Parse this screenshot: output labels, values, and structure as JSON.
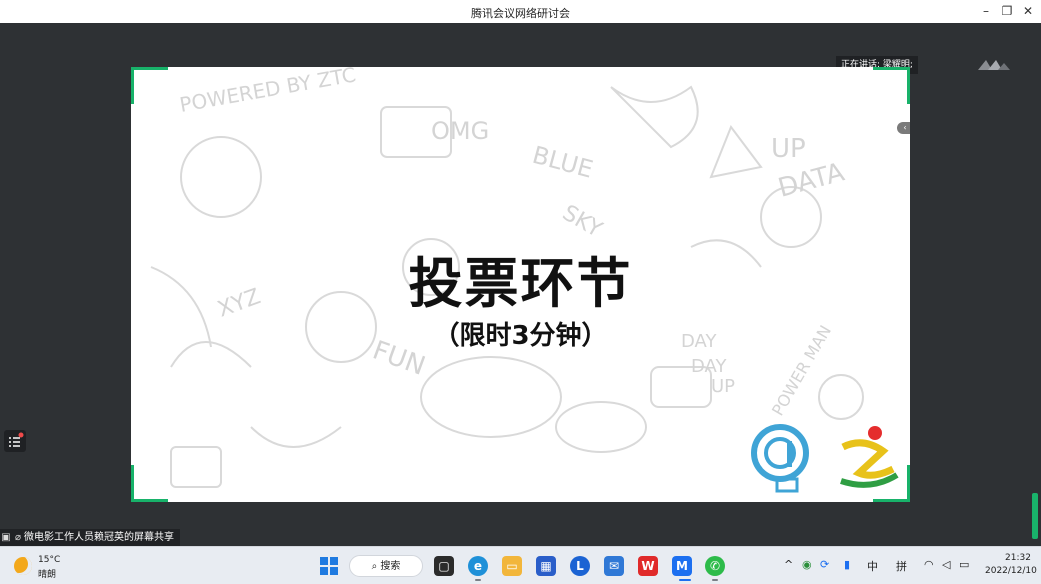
{
  "window": {
    "title": "腾讯会议网络研讨会",
    "minimize": "–",
    "maximize": "❐",
    "close": "✕"
  },
  "speaker": {
    "label": "正在讲话: 梁耀明;"
  },
  "slide": {
    "title": "投票环节",
    "subtitle": "（限时3分钟）",
    "doodle_words": [
      "POWERED BY ZTC",
      "OMG",
      "BLUE",
      "SKY",
      "UP",
      "DATA",
      "FUN",
      "XYZ",
      "DAY",
      "DAY",
      "UP",
      "POWER MAN"
    ],
    "accent_color": "#18b26a"
  },
  "share_banner": {
    "text": "微电影工作人员赖冠英的屏幕共享"
  },
  "taskbar": {
    "weather": {
      "temp": "15°C",
      "condition": "晴朗"
    },
    "search_label": "搜索",
    "ime_lang": "中",
    "ime_mode": "拼",
    "time": "21:32",
    "date": "2022/12/10"
  }
}
